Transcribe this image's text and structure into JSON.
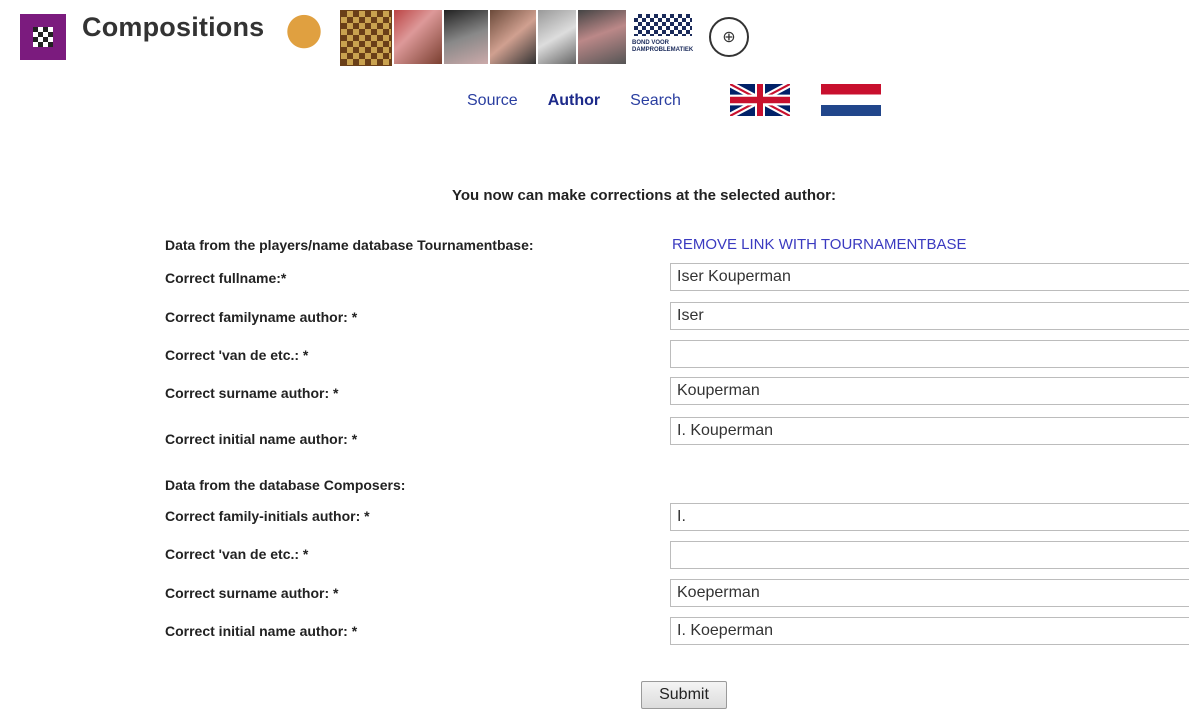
{
  "header": {
    "title": "Compositions",
    "banner_logo_text": "BOND VOOR DAMPROBLEMATIEK",
    "banner_seal_glyph": "⊕"
  },
  "nav": {
    "source": "Source",
    "author": "Author",
    "search": "Search"
  },
  "flags": {
    "uk": "flag-uk-icon",
    "nl": "flag-nl-icon"
  },
  "intro": "You now can make corrections at the selected author:",
  "section1": {
    "heading": "Data from the players/name database Tournamentbase:",
    "remove_link": "REMOVE LINK WITH TOURNAMENTBASE",
    "fields": [
      {
        "label": "Correct fullname:*",
        "value": "Iser Kouperman"
      },
      {
        "label": "Correct familyname author: *",
        "value": "Iser"
      },
      {
        "label": "Correct 'van de etc.: *",
        "value": ""
      },
      {
        "label": "Correct surname author: *",
        "value": "Kouperman"
      },
      {
        "label": "Correct initial name author: *",
        "value": "I. Kouperman"
      }
    ]
  },
  "section2": {
    "heading": "Data from the database Composers:",
    "fields": [
      {
        "label": "Correct family-initials author: *",
        "value": "I."
      },
      {
        "label": "Correct 'van de etc.: *",
        "value": ""
      },
      {
        "label": "Correct surname author: *",
        "value": "Koeperman"
      },
      {
        "label": "Correct initial name author: *",
        "value": "I. Koeperman"
      }
    ]
  },
  "submit_label": "Submit",
  "colors": {
    "logo_bg": "#7b1b7e",
    "link": "#2a3ea0",
    "nl_red": "#c8102e",
    "nl_blue": "#21468b",
    "uk_blue": "#012169"
  }
}
